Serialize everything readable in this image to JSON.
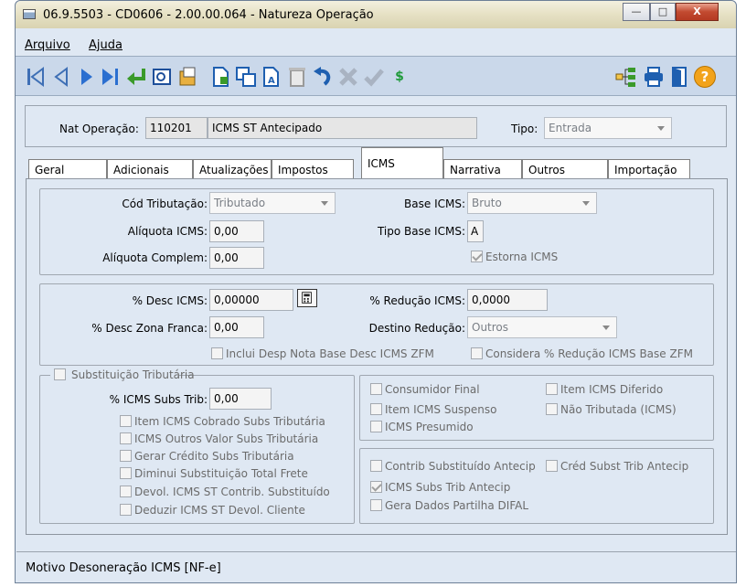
{
  "window": {
    "title": "06.9.5503 - CD0606 - 2.00.00.064 - Natureza Operação",
    "minimize": "—",
    "maximize": "□",
    "close": "X"
  },
  "menu": {
    "file": "Arquivo",
    "help": "Ajuda"
  },
  "toolbar": {
    "icons": [
      "first-icon",
      "prev-icon",
      "next-icon",
      "last-icon",
      "enter-icon",
      "zoom-icon",
      "report-icon",
      "new-icon",
      "copy-icon",
      "edit-icon",
      "delete-icon",
      "undo-icon",
      "cancel-icon",
      "confirm-icon",
      "currency-icon",
      "tree-icon",
      "print-icon",
      "exit-icon",
      "help-icon"
    ],
    "currency_symbol": "$",
    "help_symbol": "?"
  },
  "header": {
    "nat_label": "Nat Operação:",
    "nat_code": "110201",
    "nat_desc": "ICMS ST Antecipado",
    "tipo_label": "Tipo:",
    "tipo_value": "Entrada"
  },
  "tabs": [
    "Geral",
    "Adicionais",
    "Atualizações",
    "Impostos",
    "ICMS",
    "Narrativa",
    "Outros",
    "Importação"
  ],
  "active_tab": "ICMS",
  "section1": {
    "cod_trib_label": "Cód Tributação:",
    "cod_trib_value": "Tributado",
    "base_icms_label": "Base ICMS:",
    "base_icms_value": "Bruto",
    "aliquota_label": "Alíquota ICMS:",
    "aliquota_value": "0,00",
    "tipo_base_label": "Tipo Base ICMS:",
    "tipo_base_value": "A",
    "aliq_compl_label": "Alíquota Complem:",
    "aliq_compl_value": "0,00",
    "estorna_label": "Estorna ICMS",
    "estorna_checked": true
  },
  "section2": {
    "desc_icms_label": "% Desc ICMS:",
    "desc_icms_value": "0,00000",
    "reducao_label": "% Redução ICMS:",
    "reducao_value": "0,0000",
    "desc_zf_label": "% Desc Zona Franca:",
    "desc_zf_value": "0,00",
    "destino_label": "Destino Redução:",
    "destino_value": "Outros",
    "inclui_desp_label": "Inclui Desp Nota Base Desc ICMS ZFM",
    "considera_label": "Considera % Redução ICMS Base ZFM"
  },
  "subst": {
    "group_label": "Substituição Tributária",
    "icms_subs_label": "% ICMS Subs Trib:",
    "icms_subs_value": "0,00",
    "checks": [
      "Item ICMS Cobrado Subs Tributária",
      "ICMS Outros Valor Subs Tributária",
      "Gerar Crédito Subs Tributária",
      "Diminui Substituição Total Frete",
      "Devol. ICMS ST Contrib. Substituído",
      "Deduzir ICMS ST Devol. Cliente"
    ]
  },
  "right1": {
    "consumidor_final": "Consumidor Final",
    "item_icms_diferido": "Item ICMS Diferido",
    "item_icms_suspenso": "Item ICMS Suspenso",
    "nao_tributada": "Não Tributada (ICMS)",
    "icms_presumido": "ICMS Presumido"
  },
  "right2": {
    "contrib_subst": "Contrib Substituído Antecip",
    "cred_subst": "Créd Subst Trib Antecip",
    "icms_subs_antecip": "ICMS Subs Trib Antecip",
    "icms_subs_antecip_checked": true,
    "gera_dados": "Gera Dados Partilha DIFAL"
  },
  "status": {
    "text": "Motivo Desoneração ICMS [NF-e]"
  }
}
